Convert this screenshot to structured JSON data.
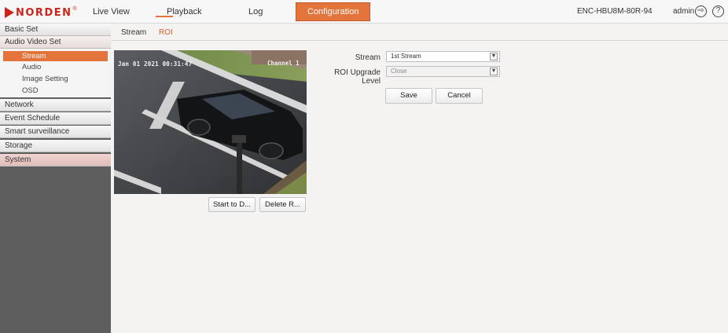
{
  "header": {
    "logo_text": "NORDEN",
    "logo_mark": "®",
    "nav": [
      "Live View",
      "Playback",
      "Log",
      "Configuration"
    ],
    "active_nav": "Configuration",
    "device_name": "ENC-HBU8M-80R-94",
    "user": "admin",
    "logout_icon": "logout-icon",
    "help_icon": "help-icon",
    "help_glyph": "?",
    "logout_glyph": "⇨"
  },
  "sidebar": {
    "sections": [
      "Basic Set",
      "Audio Video Set",
      "Network",
      "Event Schedule",
      "Smart surveillance",
      "Storage",
      "System"
    ],
    "audio_video_items": [
      "Stream",
      "Audio",
      "Image Setting",
      "OSD"
    ],
    "active_item": "Stream"
  },
  "tabs": [
    "Stream",
    "ROI"
  ],
  "active_tab": "ROI",
  "video": {
    "osd_date": "Jan 01 2021 00:31:47",
    "osd_channel": "Channel 1"
  },
  "video_buttons": [
    "Start to D...",
    "Delete R..."
  ],
  "form": {
    "stream_label": "Stream",
    "stream_value": "1st Stream",
    "roi_label": "ROI Upgrade Level",
    "roi_value": "Close",
    "save_label": "Save",
    "cancel_label": "Cancel"
  },
  "colors": {
    "accent": "#e2743c",
    "brand": "#c8261d",
    "sidebar_bg": "#5e5e5e"
  }
}
